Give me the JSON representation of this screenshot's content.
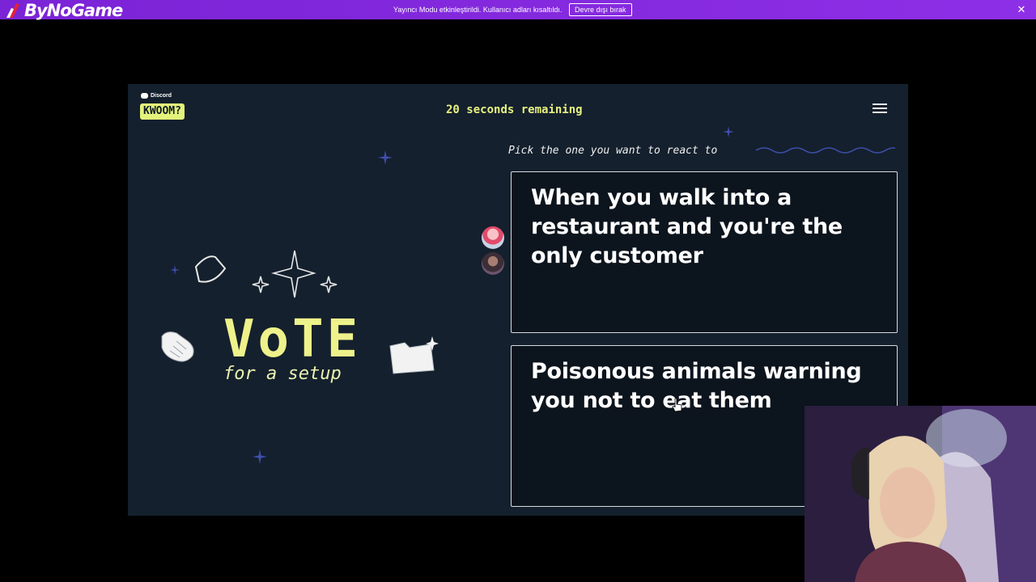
{
  "banner": {
    "brand": "ByNoGame",
    "message": "Yayıncı Modu etkinleştirildi. Kullanıcı adları kısaltıldı.",
    "disable_button": "Devre dışı bırak",
    "close_glyph": "✕"
  },
  "game": {
    "platform_label": "Discord",
    "logo_text": "KWOOM?",
    "timer_number": "20",
    "timer_text": "seconds remaining",
    "menu_icon": "hamburger-menu-icon",
    "prompt": "Pick the one you want to react to",
    "options": [
      {
        "text": "When you walk into a restaurant and you're the only customer"
      },
      {
        "text": "Poisonous animals warning you not to eat them"
      }
    ],
    "vote_title": "VoTE",
    "vote_subtitle": "for a setup"
  },
  "colors": {
    "banner": "#8a2be2",
    "frame_bg": "#14202d",
    "accent_yellow": "#e7f07f",
    "card_bg": "#0c141d"
  }
}
